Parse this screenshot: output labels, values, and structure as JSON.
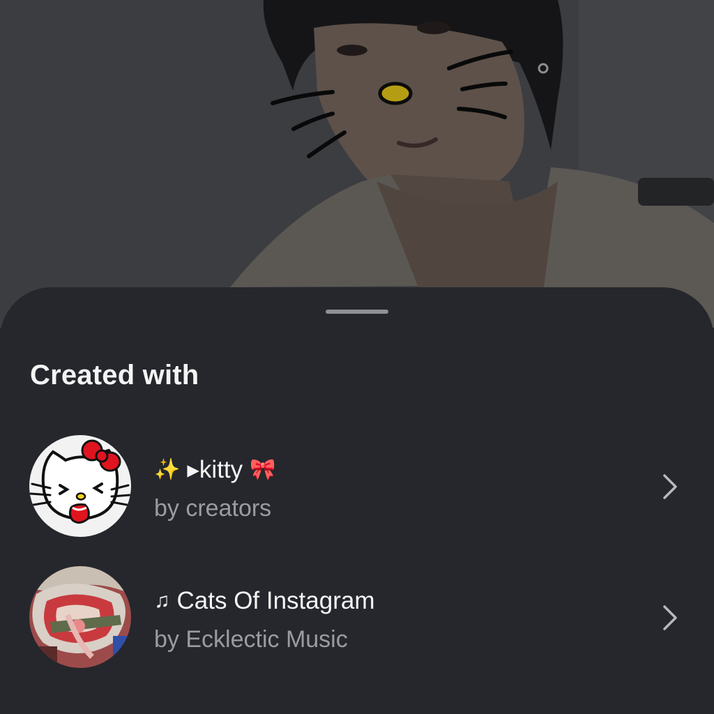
{
  "sheet": {
    "title": "Created with"
  },
  "items": [
    {
      "title": "▸kitty",
      "subtitle": "by creators",
      "leading_icon": "sparkles-icon",
      "trailing_emoji": "🎀",
      "thumbnail": "hello-kitty-effect-thumbnail"
    },
    {
      "title": "Cats Of Instagram",
      "subtitle": "by Ecklectic Music",
      "leading_icon": "music-note-icon",
      "thumbnail": "album-art-thumbnail"
    }
  ],
  "colors": {
    "sheet_background": "#25272c",
    "title_text": "#f4f4f5",
    "subtitle_text": "#9a9ca2",
    "kitty_bow": "#e0141e",
    "kitty_nose": "#f2d21a"
  }
}
